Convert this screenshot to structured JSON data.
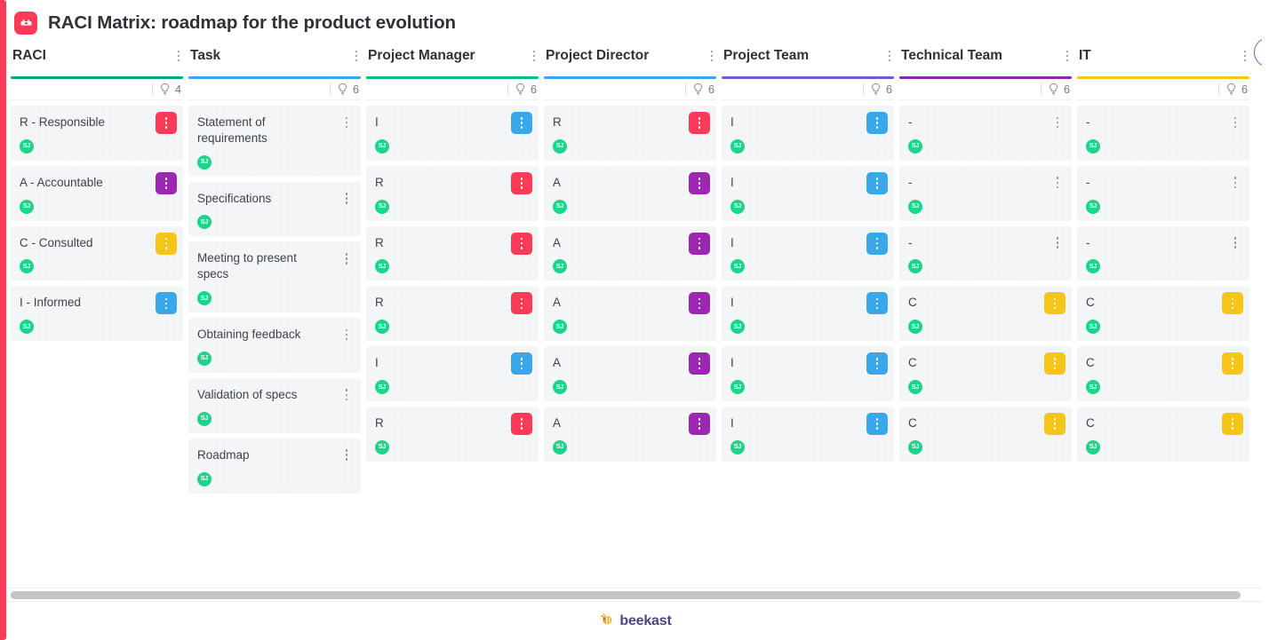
{
  "header": {
    "title": "RACI Matrix: roadmap for the product evolution",
    "logo_icon": "beekast-app-icon",
    "logo_color": "#fb3b57"
  },
  "colors": {
    "responsible": "#fb3b57",
    "accountable": "#9c27b0",
    "consulted": "#f5c518",
    "informed": "#3aa7e8",
    "avatar": "#1fd38a",
    "brand_purple": "#51437f",
    "left_rail": "#fb3b57"
  },
  "columns": [
    {
      "title": "RACI",
      "accent": "#00a881",
      "idea_count": "4",
      "menu_icon": "kebab-menu-icon",
      "idea_icon": "lightbulb-icon",
      "cards": [
        {
          "text": "R - Responsible",
          "chip_color": "#fb3b57",
          "chip_style": "filled",
          "avatar": "SJ"
        },
        {
          "text": "A - Accountable",
          "chip_color": "#9c27b0",
          "chip_style": "filled",
          "avatar": "SJ"
        },
        {
          "text": "C - Consulted",
          "chip_color": "#f5c518",
          "chip_style": "filled",
          "avatar": "SJ"
        },
        {
          "text": "I - Informed",
          "chip_color": "#3aa7e8",
          "chip_style": "filled",
          "avatar": "SJ"
        }
      ]
    },
    {
      "title": "Task",
      "accent": "#3aa7e8",
      "idea_count": "6",
      "menu_icon": "kebab-menu-icon",
      "idea_icon": "lightbulb-icon",
      "cards": [
        {
          "text": "Statement of requirements",
          "chip_color": "",
          "chip_style": "plain",
          "avatar": "SJ"
        },
        {
          "text": "Specifications",
          "chip_color": "",
          "chip_style": "plain",
          "avatar": "SJ"
        },
        {
          "text": "Meeting to present specs",
          "chip_color": "",
          "chip_style": "plain",
          "avatar": "SJ"
        },
        {
          "text": "Obtaining feedback",
          "chip_color": "",
          "chip_style": "plain",
          "avatar": "SJ"
        },
        {
          "text": "Validation of specs",
          "chip_color": "",
          "chip_style": "plain",
          "avatar": "SJ"
        },
        {
          "text": "Roadmap",
          "chip_color": "",
          "chip_style": "plain",
          "avatar": "SJ"
        }
      ]
    },
    {
      "title": "Project Manager",
      "accent": "#00c281",
      "idea_count": "6",
      "menu_icon": "kebab-menu-icon",
      "idea_icon": "lightbulb-icon",
      "cards": [
        {
          "text": "I",
          "chip_color": "#3aa7e8",
          "chip_style": "filled",
          "avatar": "SJ"
        },
        {
          "text": "R",
          "chip_color": "#fb3b57",
          "chip_style": "filled",
          "avatar": "SJ"
        },
        {
          "text": "R",
          "chip_color": "#fb3b57",
          "chip_style": "filled",
          "avatar": "SJ"
        },
        {
          "text": "R",
          "chip_color": "#fb3b57",
          "chip_style": "filled",
          "avatar": "SJ"
        },
        {
          "text": "I",
          "chip_color": "#3aa7e8",
          "chip_style": "filled",
          "avatar": "SJ"
        },
        {
          "text": "R",
          "chip_color": "#fb3b57",
          "chip_style": "filled",
          "avatar": "SJ"
        }
      ]
    },
    {
      "title": "Project Director",
      "accent": "#3aa7e8",
      "idea_count": "6",
      "menu_icon": "kebab-menu-icon",
      "idea_icon": "lightbulb-icon",
      "cards": [
        {
          "text": "R",
          "chip_color": "#fb3b57",
          "chip_style": "filled",
          "avatar": "SJ"
        },
        {
          "text": "A",
          "chip_color": "#9c27b0",
          "chip_style": "filled",
          "avatar": "SJ"
        },
        {
          "text": "A",
          "chip_color": "#9c27b0",
          "chip_style": "filled",
          "avatar": "SJ"
        },
        {
          "text": "A",
          "chip_color": "#9c27b0",
          "chip_style": "filled",
          "avatar": "SJ"
        },
        {
          "text": "A",
          "chip_color": "#9c27b0",
          "chip_style": "filled",
          "avatar": "SJ"
        },
        {
          "text": "A",
          "chip_color": "#9c27b0",
          "chip_style": "filled",
          "avatar": "SJ"
        }
      ]
    },
    {
      "title": "Project Team",
      "accent": "#6e5bd0",
      "idea_count": "6",
      "menu_icon": "kebab-menu-icon",
      "idea_icon": "lightbulb-icon",
      "cards": [
        {
          "text": "I",
          "chip_color": "#3aa7e8",
          "chip_style": "filled",
          "avatar": "SJ"
        },
        {
          "text": "I",
          "chip_color": "#3aa7e8",
          "chip_style": "filled",
          "avatar": "SJ"
        },
        {
          "text": "I",
          "chip_color": "#3aa7e8",
          "chip_style": "filled",
          "avatar": "SJ"
        },
        {
          "text": "I",
          "chip_color": "#3aa7e8",
          "chip_style": "filled",
          "avatar": "SJ"
        },
        {
          "text": "I",
          "chip_color": "#3aa7e8",
          "chip_style": "filled",
          "avatar": "SJ"
        },
        {
          "text": "I",
          "chip_color": "#3aa7e8",
          "chip_style": "filled",
          "avatar": "SJ"
        }
      ]
    },
    {
      "title": "Technical Team",
      "accent": "#8e24aa",
      "idea_count": "6",
      "menu_icon": "kebab-menu-icon",
      "idea_icon": "lightbulb-icon",
      "cards": [
        {
          "text": "-",
          "chip_color": "",
          "chip_style": "plain",
          "avatar": "SJ"
        },
        {
          "text": "-",
          "chip_color": "",
          "chip_style": "plain",
          "avatar": "SJ"
        },
        {
          "text": "-",
          "chip_color": "",
          "chip_style": "plain",
          "avatar": "SJ"
        },
        {
          "text": "C",
          "chip_color": "#f5c518",
          "chip_style": "filled",
          "avatar": "SJ"
        },
        {
          "text": "C",
          "chip_color": "#f5c518",
          "chip_style": "filled",
          "avatar": "SJ"
        },
        {
          "text": "C",
          "chip_color": "#f5c518",
          "chip_style": "filled",
          "avatar": "SJ"
        }
      ]
    },
    {
      "title": "IT",
      "accent": "#f5c518",
      "idea_count": "6",
      "menu_icon": "kebab-menu-icon",
      "idea_icon": "lightbulb-icon",
      "cards": [
        {
          "text": "-",
          "chip_color": "",
          "chip_style": "plain",
          "avatar": "SJ"
        },
        {
          "text": "-",
          "chip_color": "",
          "chip_style": "plain",
          "avatar": "SJ"
        },
        {
          "text": "-",
          "chip_color": "",
          "chip_style": "plain",
          "avatar": "SJ"
        },
        {
          "text": "C",
          "chip_color": "#f5c518",
          "chip_style": "filled",
          "avatar": "SJ"
        },
        {
          "text": "C",
          "chip_color": "#f5c518",
          "chip_style": "filled",
          "avatar": "SJ"
        },
        {
          "text": "C",
          "chip_color": "#f5c518",
          "chip_style": "filled",
          "avatar": "SJ"
        }
      ]
    }
  ],
  "footer": {
    "brand": "beekast",
    "brand_icon": "bee-logo-icon"
  }
}
